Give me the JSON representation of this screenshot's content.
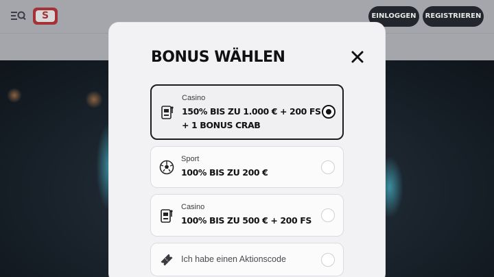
{
  "header": {
    "menu_icon": "menu-search-icon",
    "logo_text": "S",
    "login_label": "EINLOGGEN",
    "register_label": "REGISTRIEREN"
  },
  "modal": {
    "title": "BONUS WÄHLEN",
    "close_icon": "close-icon",
    "options": [
      {
        "category": "Casino",
        "title_line1": "150% BIS ZU 1.000 € + 200 FS",
        "title_line2": "+ 1 BONUS CRAB",
        "icon": "slot-machine-icon",
        "selected": true
      },
      {
        "category": "Sport",
        "title_line1": "100% BIS ZU 200 €",
        "icon": "soccer-ball-icon",
        "selected": false
      },
      {
        "category": "Casino",
        "title_line1": "100% BIS ZU 500 € + 200 FS",
        "icon": "slot-machine-icon",
        "selected": false
      }
    ],
    "promo_code_label": "Ich habe einen Aktionscode",
    "promo_icon": "ticket-icon"
  },
  "colors": {
    "accent": "#a53236",
    "dark_button": "#23262c",
    "modal_bg": "#f2f2f4"
  }
}
